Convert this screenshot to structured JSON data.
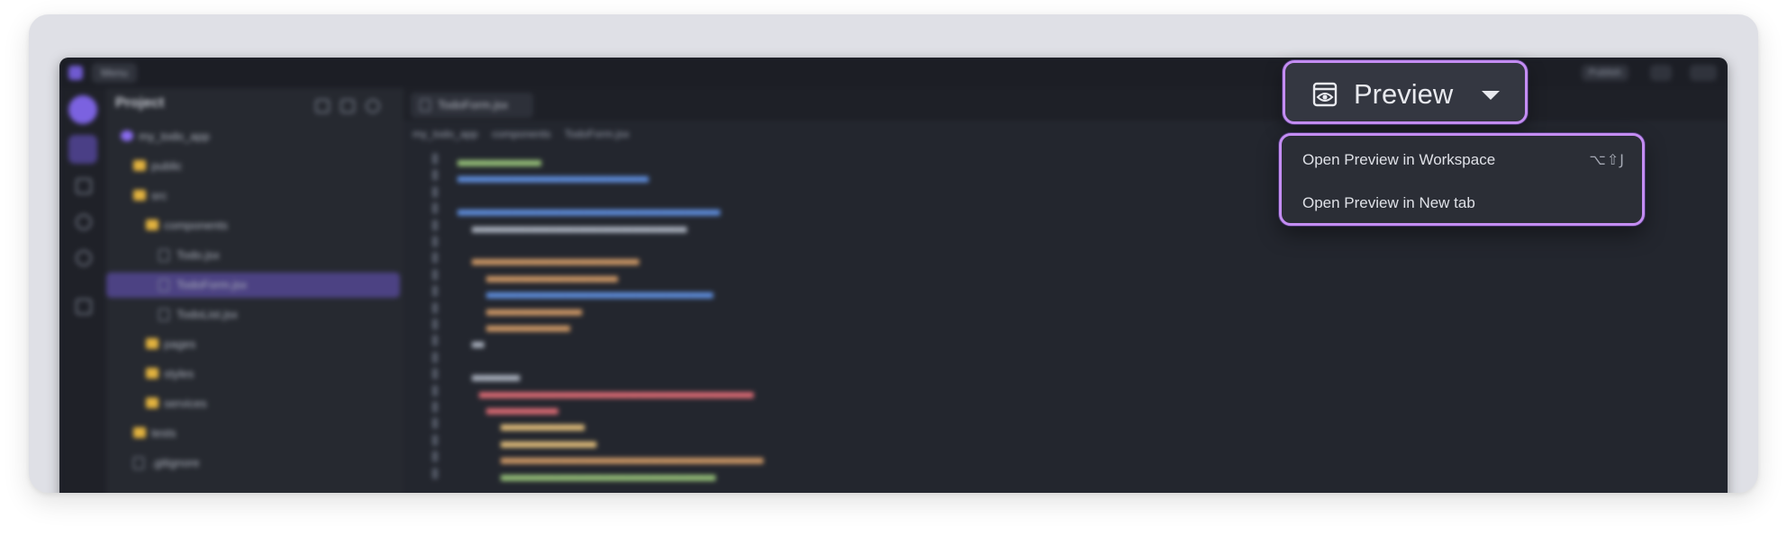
{
  "ide": {
    "titlebar": {
      "menu_label": "Menu",
      "right_button": "Publish"
    },
    "sidebar": {
      "title": "Project",
      "tree": [
        {
          "label": "my_todo_app",
          "kind": "root",
          "indent": 0
        },
        {
          "label": "public",
          "kind": "folder",
          "indent": 1
        },
        {
          "label": "src",
          "kind": "folder",
          "indent": 1
        },
        {
          "label": "components",
          "kind": "folder",
          "indent": 2
        },
        {
          "label": "Todo.jsx",
          "kind": "file",
          "indent": 3
        },
        {
          "label": "TodoForm.jsx",
          "kind": "file",
          "indent": 3,
          "selected": true
        },
        {
          "label": "TodoList.jsx",
          "kind": "file",
          "indent": 3
        },
        {
          "label": "pages",
          "kind": "folder",
          "indent": 2
        },
        {
          "label": "styles",
          "kind": "folder",
          "indent": 2
        },
        {
          "label": "services",
          "kind": "folder",
          "indent": 2
        },
        {
          "label": "tests",
          "kind": "folder",
          "indent": 1
        },
        {
          "label": ".gitignore",
          "kind": "file",
          "indent": 1
        }
      ]
    },
    "editor": {
      "tab_label": "TodoForm.jsx",
      "breadcrumbs": [
        "my_todo_app",
        "components",
        "TodoForm.jsx"
      ]
    }
  },
  "preview_button": {
    "label": "Preview",
    "icon": "eye-window-icon"
  },
  "preview_menu": {
    "items": [
      {
        "label": "Open Preview in Workspace",
        "shortcut": "⌥⇧J"
      },
      {
        "label": "Open Preview in New tab",
        "shortcut": ""
      }
    ]
  },
  "colors": {
    "highlight_border": "#c48df2",
    "ide_background": "#23262e",
    "selection": "#4c4283",
    "outer_frame": "#dfe0e6"
  }
}
